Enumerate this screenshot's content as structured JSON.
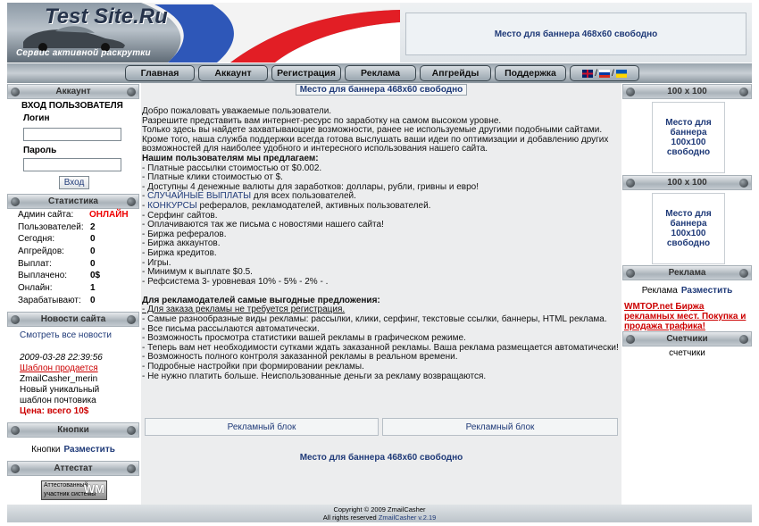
{
  "header": {
    "logo_title": "Test Site.Ru",
    "logo_subtitle": "Сервис активной раскрутки",
    "top_banner": "Место для баннера 468x60 свободно"
  },
  "nav": {
    "items": [
      "Главная",
      "Аккаунт",
      "Регистрация",
      "Реклама",
      "Апгрейды",
      "Поддержка"
    ],
    "lang_sep": "/"
  },
  "left": {
    "account": {
      "header": "Аккаунт",
      "title": "ВХОД ПОЛЬЗОВАТЕЛЯ",
      "login_label": "Логин",
      "password_label": "Пароль",
      "login_value": "",
      "password_value": "",
      "submit": "Вход"
    },
    "stats": {
      "header": "Статистика",
      "rows": [
        {
          "k": "Админ сайта:",
          "v": "ОНЛАЙН"
        },
        {
          "k": "Пользователей:",
          "v": "2"
        },
        {
          "k": "Сегодня:",
          "v": "0"
        },
        {
          "k": "Апгрейдов:",
          "v": "0"
        },
        {
          "k": "Выплат:",
          "v": "0"
        },
        {
          "k": "Выплачено:",
          "v": "0$"
        },
        {
          "k": "Онлайн:",
          "v": "1"
        },
        {
          "k": "Зарабатывают:",
          "v": "0"
        }
      ]
    },
    "news": {
      "header": "Новости сайта",
      "all_link": "Смотреть все новости",
      "date": "2009-03-28 22:39:56",
      "title": "Шаблон продается",
      "author": "ZmailCasher_merin",
      "line1": "Новый уникальный",
      "line2": "шаблон почтовика",
      "price": "Цена: всего 10$"
    },
    "buttons": {
      "header": "Кнопки",
      "label": "Кнопки",
      "link": "Разместить"
    },
    "attest": {
      "header": "Аттестат",
      "line1": "Аттестованный",
      "line2": "участник",
      "line3": "системы",
      "logo": "WM"
    }
  },
  "center": {
    "banner_top": "Место для баннера 468x60 свободно",
    "banner_bottom": "Место для баннера 468x60 свободно",
    "intro": [
      "Добро пожаловать уважаемые пользователи.",
      "Разрешите представить вам интернет-ресурс по заработку на самом высоком уровне.",
      "Только здесь вы найдете захватывающие возможности, ранее не используемые другими подобными сайтами.",
      "Кроме того, наша служба поддержки всегда готова выслушать ваши идеи по оптимизации и добавлению других возможностей для наиболее удобного и интересного использования нашего сайта."
    ],
    "users_heading": "Нашим пользователям мы предлагаем:",
    "users_list": [
      "- Платные рассылки стоимостью от $0.002.",
      "- Платные клики стоимостью от $.",
      "- Доступны 4 денежные валюты для заработков: доллары, рубли, гривны и евро!",
      "- ",
      "- ",
      "- Серфинг сайтов.",
      "- Оплачиваются так же письма с новостями нашего сайта!",
      "- Биржа рефералов.",
      "- Биржа аккаунтов.",
      "- Биржа кредитов.",
      "- Игры.",
      "- Минимум к выплате $0.5.",
      "- Рефсистема 3- уровневая 10% - 5% - 2% - ."
    ],
    "link_payouts": "СЛУЧАЙНЫЕ ВЫПЛАТЫ",
    "payouts_rest": " для всех пользователей.",
    "link_contests": "КОНКУРСЫ",
    "contests_rest": " рефералов, рекламодателей, активных пользователей.",
    "adv_heading": "Для рекламодателей самые выгодные предложения:",
    "adv_list": [
      "- Для заказа рекламы не требуется регистрация.",
      "- Самые разнообразные виды рекламы: рассылки, клики, серфинг, текстовые ссылки, баннеры, HTML реклама.",
      "- Все письма рассылаются автоматически.",
      "- Возможность просмотра статистики вашей рекламы в графическом режиме.",
      "- Теперь вам нет необходимости сутками ждать заказанной рекламы. Ваша реклама размещается автоматически!",
      "- Возможность полного контроля заказанной рекламы в реальном времени.",
      "- Подробные настройки при формировании рекламы.",
      "- Не нужно платить больше. Неиспользованные деньги за рекламу возвращаются."
    ],
    "ad_block_1": "Рекламный блок",
    "ad_block_2": "Рекламный блок"
  },
  "right": {
    "box1_header": "100 x 100",
    "box1_text": "Место для баннера 100x100 свободно",
    "box2_header": "100 x 100",
    "box2_text": "Место для баннера 100x100 свободно",
    "ads_header": "Реклама",
    "ads_label": "Реклама",
    "ads_link": "Разместить",
    "wmtop_text": "WMTOP.net Биржа рекламных мест. Покупка и продажа трафика!",
    "counters_header": "Счетчики",
    "counters_text": "счетчики"
  },
  "footer": {
    "copyright": "Copyright © 2009 ZmailCasher",
    "rights": "All rights reserved",
    "version_link": "ZmailCasher v.2.19"
  },
  "colors": {
    "accent": "#1f3a78",
    "online": "#e00000",
    "link_red": "#cc0000"
  }
}
